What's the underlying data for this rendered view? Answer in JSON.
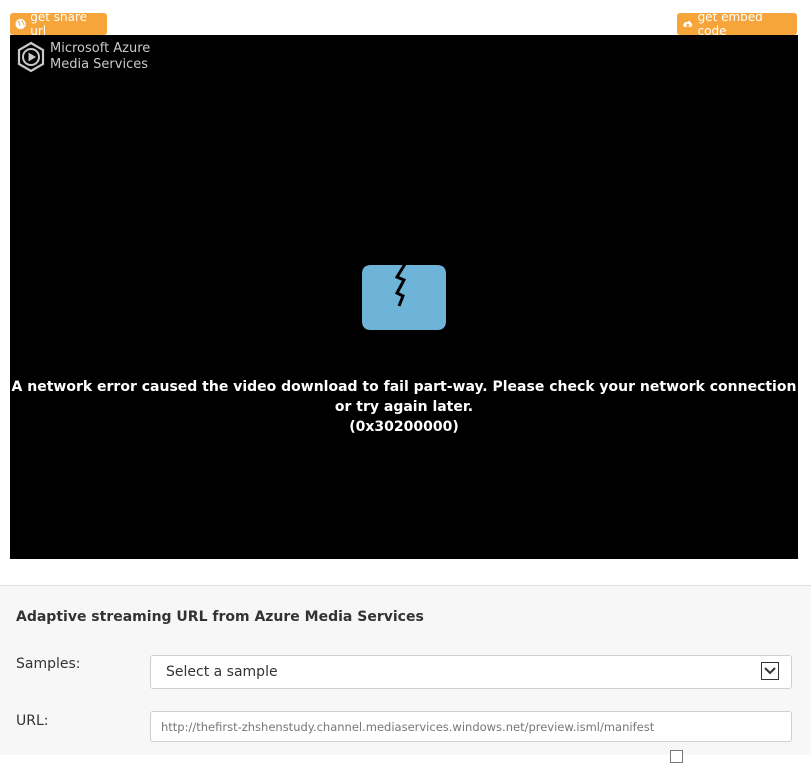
{
  "toolbar": {
    "share_label": "get share url",
    "share_icon": "globe-icon",
    "embed_label": "get embed code",
    "embed_icon": "cloud-upload-icon",
    "accent_color": "#f5a53a"
  },
  "player": {
    "brand_line1": "Microsoft Azure",
    "brand_line2": "Media Services",
    "error_icon": "broken-screen-icon",
    "error_icon_color": "#6eb4d8",
    "error_message": "A network error caused the video download to fail part-way. Please check your network connection or try again later.",
    "error_code": "(0x30200000)"
  },
  "form": {
    "title": "Adaptive streaming URL from Azure Media Services",
    "samples_label": "Samples:",
    "samples_selected": "Select a sample",
    "url_label": "URL:",
    "url_value": "http://thefirst-zhshenstudy.channel.mediaservices.windows.net/preview.isml/manifest"
  }
}
